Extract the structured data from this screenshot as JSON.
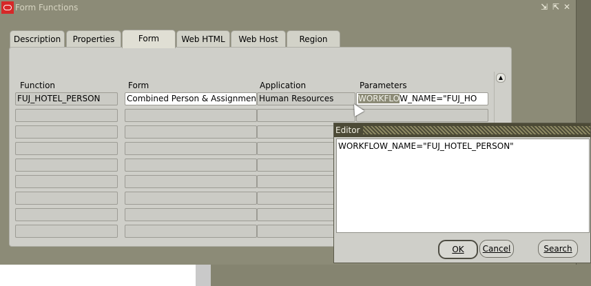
{
  "window": {
    "title": "Form Functions",
    "controls": [
      "minimize",
      "maximize",
      "close"
    ]
  },
  "tabs": [
    {
      "label": "Description",
      "active": false
    },
    {
      "label": "Properties",
      "active": false
    },
    {
      "label": "Form",
      "active": true
    },
    {
      "label": "Web HTML",
      "active": false
    },
    {
      "label": "Web Host",
      "active": false
    },
    {
      "label": "Region",
      "active": false
    }
  ],
  "table": {
    "columns": [
      "Function",
      "Form",
      "Application",
      "Parameters"
    ],
    "rows": [
      {
        "function": "FUJ_HOTEL_PERSON",
        "form": "Combined Person & Assignment",
        "application": "Human Resources",
        "parameters_highlight": "WORKFLO",
        "parameters_rest": "W_NAME=\"FUJ_HO"
      }
    ],
    "empty_rows": 8
  },
  "editor": {
    "title": "Editor",
    "text": "WORKFLOW_NAME=\"FUJ_HOTEL_PERSON\"",
    "buttons": {
      "ok": "OK",
      "cancel": "Cancel",
      "search": "Search"
    }
  }
}
